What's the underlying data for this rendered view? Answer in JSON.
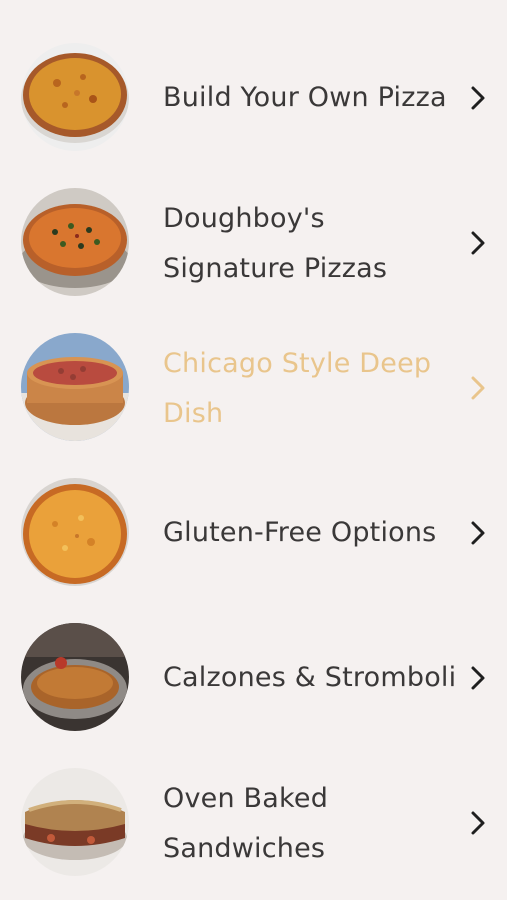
{
  "menu": {
    "items": [
      {
        "label": "Build Your Own Pizza",
        "icon": "chevron-right-icon",
        "image": "cheese-pizza-photo",
        "state": "normal"
      },
      {
        "label": "Doughboy's Signature Pizzas",
        "icon": "chevron-right-icon",
        "image": "loaded-pizza-photo",
        "state": "normal"
      },
      {
        "label": "Chicago Style Deep Dish",
        "icon": "chevron-right-icon",
        "image": "deep-dish-pizza-photo",
        "state": "pressed"
      },
      {
        "label": "Gluten-Free Options",
        "icon": "chevron-right-icon",
        "image": "gluten-free-pizza-photo",
        "state": "normal"
      },
      {
        "label": "Calzones & Stromboli",
        "icon": "chevron-right-icon",
        "image": "calzone-photo",
        "state": "normal"
      },
      {
        "label": "Oven Baked Sandwiches",
        "icon": "chevron-right-icon",
        "image": "sandwich-photo",
        "state": "normal"
      }
    ]
  },
  "colors": {
    "background": "#f5f1f0",
    "text": "#3a3838",
    "pressed_text": "#e9c58c"
  }
}
